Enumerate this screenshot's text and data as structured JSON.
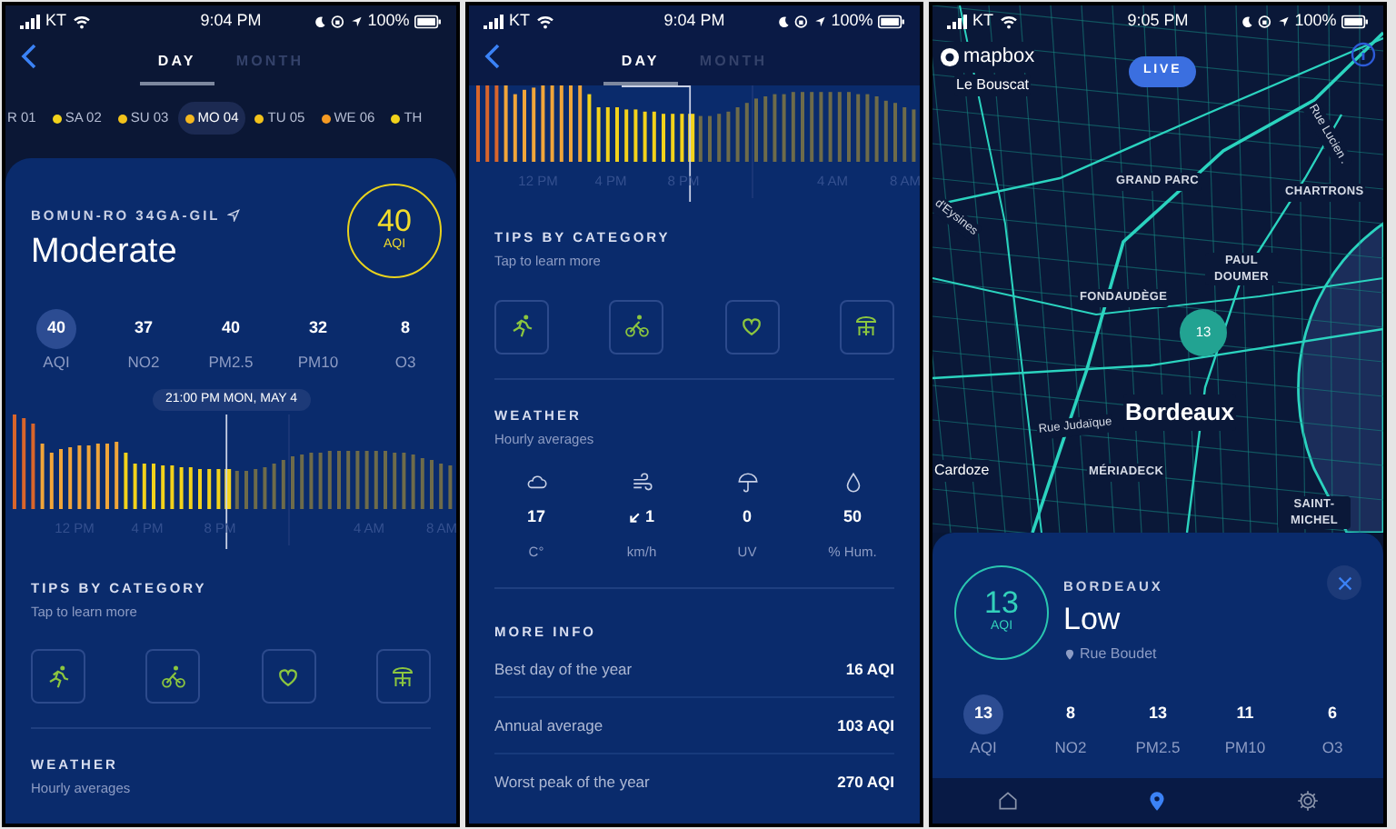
{
  "day_screen": {
    "status_bar": {
      "carrier": "KT",
      "time": "9:04 PM",
      "battery": "100%"
    },
    "tabs": [
      {
        "label": "DAY",
        "selected": true
      },
      {
        "label": "MONTH",
        "selected": false
      }
    ],
    "days": [
      {
        "label": "R 01",
        "selected": false
      },
      {
        "label": "SA 02",
        "color": "#f2d21b",
        "selected": false
      },
      {
        "label": "SU 03",
        "color": "#f2c21b",
        "selected": false
      },
      {
        "label": "MO 04",
        "color": "#f5b820",
        "selected": true
      },
      {
        "label": "TU 05",
        "color": "#f2c21b",
        "selected": false
      },
      {
        "label": "WE 06",
        "color": "#f59a23",
        "selected": false
      },
      {
        "label": "TH",
        "color": "#f2d21b",
        "selected": false
      }
    ],
    "location": "BOMUN-RO 34GA-GIL",
    "quality": "Moderate",
    "aqi": {
      "value": "40",
      "unit": "AQI"
    },
    "pollutants": [
      {
        "value": "40",
        "label": "AQI",
        "selected": true
      },
      {
        "value": "37",
        "label": "NO2",
        "selected": false
      },
      {
        "value": "40",
        "label": "PM2.5",
        "selected": false
      },
      {
        "value": "32",
        "label": "PM10",
        "selected": false
      },
      {
        "value": "8",
        "label": "O3",
        "selected": false
      }
    ],
    "tooltip": "21:00 PM MON, MAY 4",
    "chart_axis": [
      "12 PM",
      "4 PM",
      "8 PM",
      "4 AM",
      "8 AM"
    ],
    "tips": {
      "title": "TIPS BY CATEGORY",
      "subtitle": "Tap to learn more"
    },
    "weather": {
      "title": "WEATHER",
      "subtitle": "Hourly averages"
    }
  },
  "day_screen_scrolled": {
    "status_bar": {
      "carrier": "KT",
      "time": "9:04 PM",
      "battery": "100%"
    },
    "tabs": [
      {
        "label": "DAY",
        "selected": true
      },
      {
        "label": "MONTH",
        "selected": false
      }
    ],
    "chart_axis": [
      "12 PM",
      "4 PM",
      "8 PM",
      "4 AM",
      "8 AM"
    ],
    "tips": {
      "title": "TIPS BY CATEGORY",
      "subtitle": "Tap to learn more"
    },
    "weather": {
      "title": "WEATHER",
      "subtitle": "Hourly averages",
      "items": [
        {
          "kind": "cloud",
          "value": "17",
          "unit": "C°"
        },
        {
          "kind": "wind",
          "value": "1",
          "unit": "km/h"
        },
        {
          "kind": "umbrella",
          "value": "0",
          "unit": "UV"
        },
        {
          "kind": "drop",
          "value": "50",
          "unit": "% Hum."
        }
      ]
    },
    "more_info": {
      "title": "MORE INFO",
      "rows": [
        {
          "label": "Best day of the year",
          "value": "16 AQI"
        },
        {
          "label": "Annual average",
          "value": "103 AQI"
        },
        {
          "label": "Worst peak of the year",
          "value": "270 AQI"
        }
      ]
    }
  },
  "map_screen": {
    "status_bar": {
      "carrier": "KT",
      "time": "9:05 PM",
      "battery": "100%"
    },
    "brand": "mapbox",
    "live": "LIVE",
    "map_labels": [
      {
        "text": "Le Bouscat",
        "kind": "town"
      },
      {
        "text": "GRAND PARC",
        "kind": "district"
      },
      {
        "text": "CHARTRONS",
        "kind": "district"
      },
      {
        "text": "Rue Lucien .",
        "kind": "street"
      },
      {
        "text": "d'Eysines",
        "kind": "street"
      },
      {
        "text": "PAUL DOUMER",
        "kind": "district"
      },
      {
        "text": "FONDAUDÈGE",
        "kind": "district"
      },
      {
        "text": "Bordeaux",
        "kind": "city"
      },
      {
        "text": "Rue Judaïque",
        "kind": "street"
      },
      {
        "text": "Cardoze",
        "kind": "town"
      },
      {
        "text": "MÉRIADECK",
        "kind": "district"
      },
      {
        "text": "SAINT-MICHEL",
        "kind": "district"
      }
    ],
    "marker": "13",
    "sheet": {
      "aqi": {
        "value": "13",
        "unit": "AQI"
      },
      "city": "BORDEAUX",
      "quality": "Low",
      "address": "Rue Boudet",
      "pollutants": [
        {
          "value": "13",
          "label": "AQI",
          "selected": true
        },
        {
          "value": "8",
          "label": "NO2",
          "selected": false
        },
        {
          "value": "13",
          "label": "PM2.5",
          "selected": false
        },
        {
          "value": "11",
          "label": "PM10",
          "selected": false
        },
        {
          "value": "6",
          "label": "O3",
          "selected": false
        }
      ]
    },
    "nav": [
      {
        "kind": "home",
        "selected": false
      },
      {
        "kind": "map",
        "selected": true
      },
      {
        "kind": "settings",
        "selected": false
      }
    ]
  }
}
